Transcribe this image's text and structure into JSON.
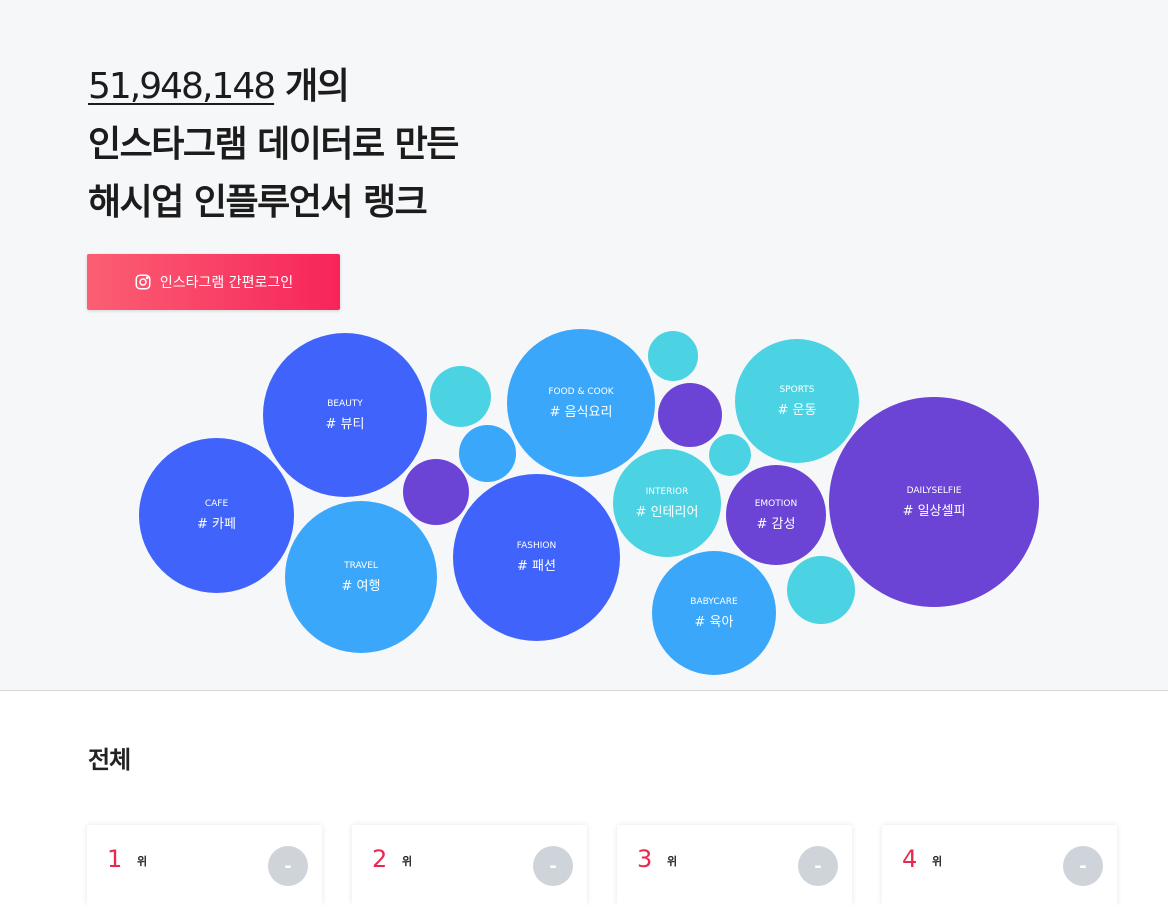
{
  "hero": {
    "count": "51,948,148",
    "count_suffix": " 개의",
    "line2": "인스타그램 데이터로 만든",
    "line3": "해시업 인플루언서 랭크",
    "login_label": "인스타그램 간편로그인"
  },
  "categories": [
    {
      "en": "BEAUTY",
      "ko": "# 뷰티",
      "color": "#3f63fb"
    },
    {
      "en": "CAFE",
      "ko": "# 카페",
      "color": "#3f63fb"
    },
    {
      "en": "TRAVEL",
      "ko": "# 여행",
      "color": "#3aa7fb"
    },
    {
      "en": "FOOD & COOK",
      "ko": "# 음식요리",
      "color": "#3aa7fb"
    },
    {
      "en": "FASHION",
      "ko": "# 패션",
      "color": "#3f63fb"
    },
    {
      "en": "INTERIOR",
      "ko": "# 인테리어",
      "color": "#4bd3e3"
    },
    {
      "en": "SPORTS",
      "ko": "# 운동",
      "color": "#4bd3e3"
    },
    {
      "en": "EMOTION",
      "ko": "# 감성",
      "color": "#6b44d6"
    },
    {
      "en": "BABYCARE",
      "ko": "# 육아",
      "color": "#3aa7fb"
    },
    {
      "en": "DAILYSELFIE",
      "ko": "# 일상셀피",
      "color": "#6b44d6"
    }
  ],
  "section": {
    "title": "전체"
  },
  "ranks": [
    {
      "rank": "1",
      "suffix": "위",
      "avatar": "-"
    },
    {
      "rank": "2",
      "suffix": "위",
      "avatar": "-"
    },
    {
      "rank": "3",
      "suffix": "위",
      "avatar": "-"
    },
    {
      "rank": "4",
      "suffix": "위",
      "avatar": "-"
    }
  ],
  "colors": {
    "accent_pink": "#f7245a",
    "blue": "#3f63fb",
    "sky": "#3aa7fb",
    "cyan": "#4bd3e3",
    "purple": "#6b44d6"
  }
}
